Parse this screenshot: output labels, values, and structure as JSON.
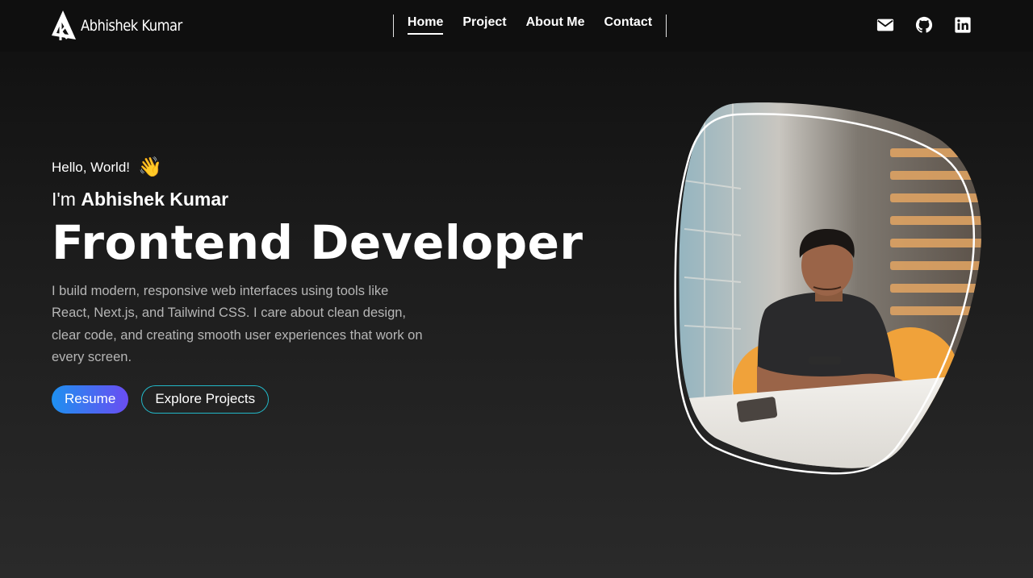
{
  "brand": {
    "name": "Abhishek Kumar"
  },
  "nav": {
    "items": [
      {
        "label": "Home",
        "active": true
      },
      {
        "label": "Project",
        "active": false
      },
      {
        "label": "About Me",
        "active": false
      },
      {
        "label": "Contact",
        "active": false
      }
    ]
  },
  "social": [
    {
      "icon": "mail-icon"
    },
    {
      "icon": "github-icon"
    },
    {
      "icon": "linkedin-icon"
    }
  ],
  "hero": {
    "greeting": "Hello, World!",
    "wave_emoji": "👋",
    "intro_prefix": "I'm",
    "name": "Abhishek Kumar",
    "title": "Frontend Developer",
    "description": "I build modern, responsive web interfaces using tools like React, Next.js, and Tailwind CSS. I care about clean design, clear code, and creating smooth user experiences that work on every screen.",
    "buttons": {
      "primary": "Resume",
      "secondary": "Explore Projects"
    }
  },
  "colors": {
    "background_top": "#0f0f0f",
    "background_bottom": "#2a2a2a",
    "text": "#ffffff",
    "muted_text": "#b6b6b6",
    "primary_gradient_start": "#1e90f0",
    "primary_gradient_end": "#6a4df2",
    "outline_accent": "#22b8c8"
  }
}
